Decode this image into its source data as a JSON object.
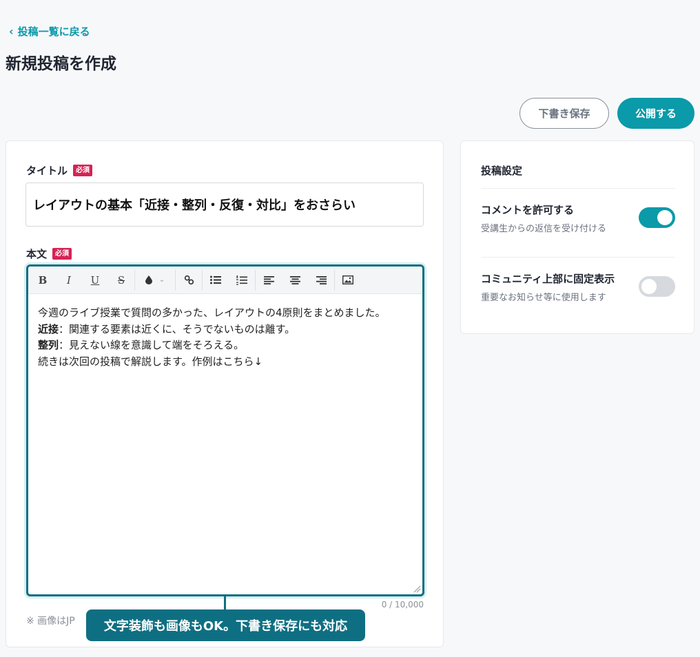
{
  "nav": {
    "back_label": "投稿一覧に戻る"
  },
  "page": {
    "title": "新規投稿を作成"
  },
  "actions": {
    "draft_label": "下書き保存",
    "publish_label": "公開する"
  },
  "form": {
    "title_label": "タイトル",
    "required_badge": "必須",
    "title_value": "レイアウトの基本「近接・整列・反復・対比」をおさらい",
    "body_label": "本文",
    "body_lines": [
      {
        "text": "今週のライブ授業で質問の多かった、レイアウトの4原則をまとめました。"
      },
      {
        "bold": "近接",
        "text": "：関連する要素は近くに、そうでないものは離す。"
      },
      {
        "bold": "整列",
        "text": "：見えない線を意識して端をそろえる。"
      },
      {
        "text": "続きは次回の投稿で解説します。作例はこちら↓"
      }
    ],
    "char_counter": "0 / 10,000",
    "note_text": "※ 画像はJP"
  },
  "toolbar": {
    "bold": "B",
    "italic": "I",
    "underline": "U",
    "strike": "S",
    "icons": [
      "bold-icon",
      "italic-icon",
      "underline-icon",
      "strikethrough-icon",
      "text-color-icon",
      "link-icon",
      "bullet-list-icon",
      "numbered-list-icon",
      "align-left-icon",
      "align-center-icon",
      "align-right-icon",
      "image-icon"
    ]
  },
  "callout": {
    "text": "文字装飾も画像もOK。下書き保存にも対応"
  },
  "settings": {
    "title": "投稿設定",
    "items": [
      {
        "title": "コメントを許可する",
        "desc": "受講生からの返信を受け付ける",
        "enabled": true
      },
      {
        "title": "コミュニティ上部に固定表示",
        "desc": "重要なお知らせ等に使用します",
        "enabled": false
      }
    ]
  },
  "colors": {
    "accent": "#0a9aa9",
    "editor_border": "#0f6f82",
    "required": "#d62356"
  }
}
